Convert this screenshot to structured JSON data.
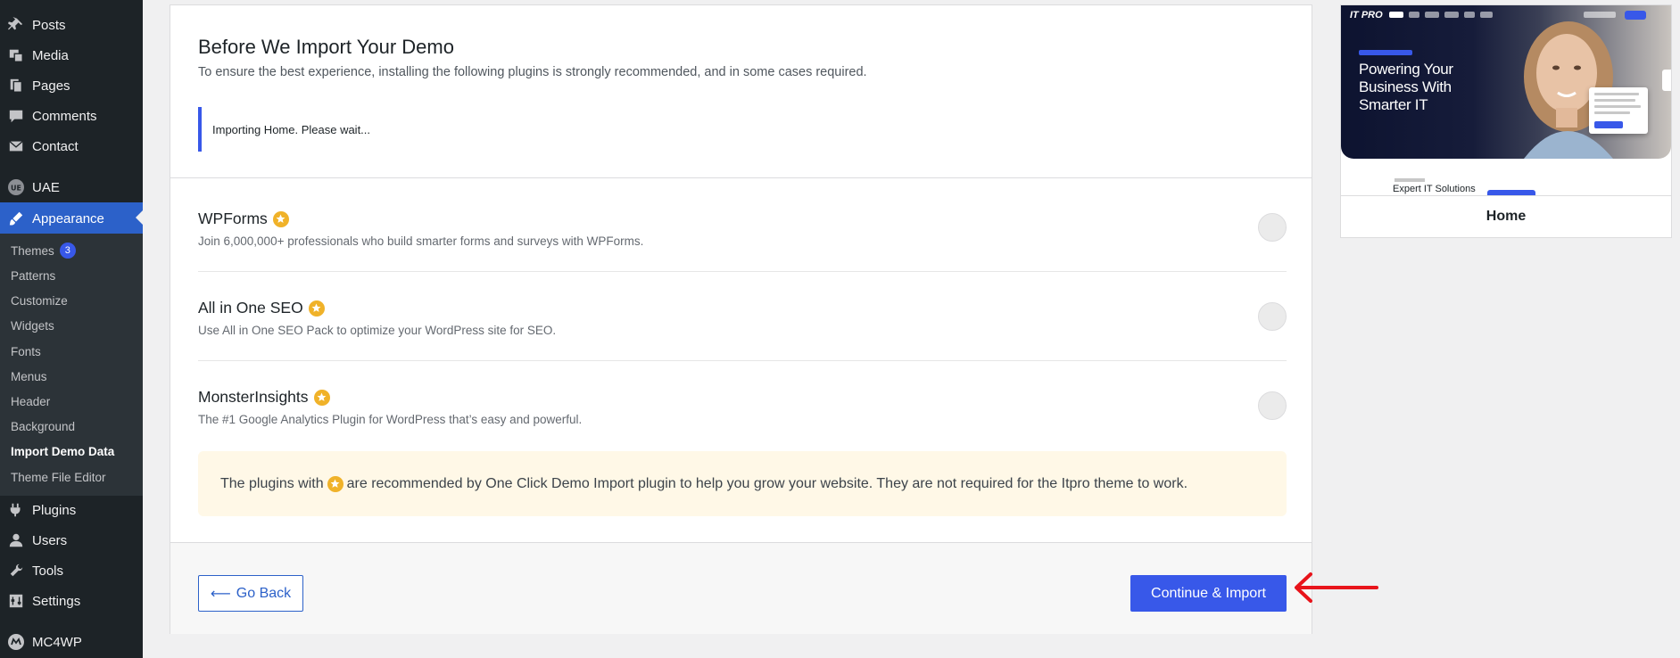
{
  "sidebar": {
    "items_top": [
      {
        "label": "Posts",
        "icon": "pin-icon"
      },
      {
        "label": "Media",
        "icon": "media-icon"
      },
      {
        "label": "Pages",
        "icon": "pages-icon"
      },
      {
        "label": "Comments",
        "icon": "comments-icon"
      },
      {
        "label": "Contact",
        "icon": "mail-icon"
      },
      {
        "label": "UAE",
        "icon": "uae-icon"
      },
      {
        "label": "Appearance",
        "icon": "brush-icon"
      }
    ],
    "submenu": [
      {
        "label": "Themes",
        "badge": "3"
      },
      {
        "label": "Patterns"
      },
      {
        "label": "Customize"
      },
      {
        "label": "Widgets"
      },
      {
        "label": "Fonts"
      },
      {
        "label": "Menus"
      },
      {
        "label": "Header"
      },
      {
        "label": "Background"
      },
      {
        "label": "Import Demo Data"
      },
      {
        "label": "Theme File Editor"
      }
    ],
    "items_bottom": [
      {
        "label": "Plugins",
        "icon": "plugin-icon"
      },
      {
        "label": "Users",
        "icon": "user-icon"
      },
      {
        "label": "Tools",
        "icon": "wrench-icon"
      },
      {
        "label": "Settings",
        "icon": "settings-icon"
      },
      {
        "label": "MC4WP",
        "icon": "mc4wp-icon"
      }
    ]
  },
  "main": {
    "title": "Before We Import Your Demo",
    "subtitle": "To ensure the best experience, installing the following plugins is strongly recommended, and in some cases required.",
    "notice": "Importing Home. Please wait...",
    "plugins": [
      {
        "name": "WPForms",
        "description": "Join 6,000,000+ professionals who build smarter forms and surveys with WPForms."
      },
      {
        "name": "All in One SEO",
        "description": "Use All in One SEO Pack to optimize your WordPress site for SEO."
      },
      {
        "name": "MonsterInsights",
        "description": "The #1 Google Analytics Plugin for WordPress that’s easy and powerful."
      }
    ],
    "recommendation": {
      "before": "The plugins with",
      "after": "are recommended by One Click Demo Import plugin to help you grow your website. They are not required for the Itpro theme to work."
    },
    "go_back_label": "Go Back",
    "continue_label": "Continue & Import"
  },
  "preview": {
    "logo": "IT PRO",
    "hero_text": "Powering Your Business With Smarter IT",
    "below_hero": "Expert IT Solutions",
    "label": "Home"
  },
  "colors": {
    "accent": "#3858e9",
    "sidebar_bg": "#1d2327",
    "star": "#f0b229",
    "annotation": "#e8141b"
  }
}
